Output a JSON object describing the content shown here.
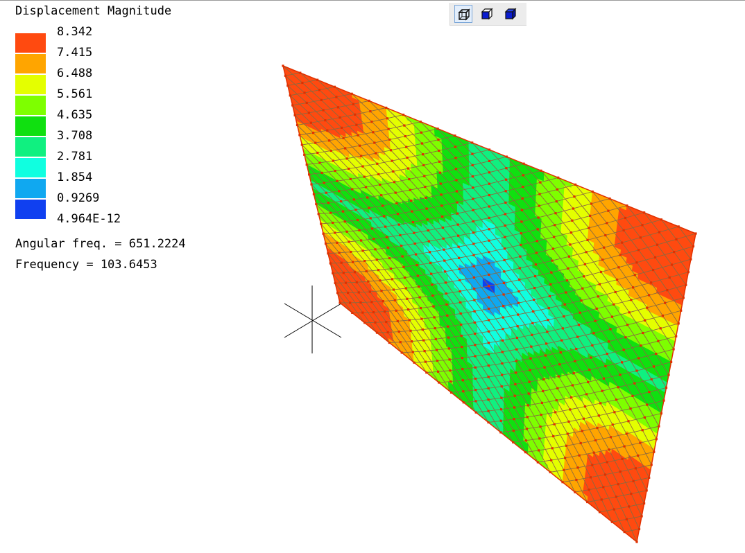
{
  "legend": {
    "title": "Displacement Magnitude",
    "entries": [
      {
        "label": "8.342",
        "color": "#ff4a10"
      },
      {
        "label": "7.415",
        "color": "#ffa500"
      },
      {
        "label": "6.488",
        "color": "#e4ff00"
      },
      {
        "label": "5.561",
        "color": "#7eff00"
      },
      {
        "label": "4.635",
        "color": "#10e010"
      },
      {
        "label": "3.708",
        "color": "#10f080"
      },
      {
        "label": "2.781",
        "color": "#10ffe0"
      },
      {
        "label": "1.854",
        "color": "#10a8f0"
      },
      {
        "label": "0.9269",
        "color": "#1040f0"
      },
      {
        "label": "4.964E-12",
        "color": ""
      }
    ]
  },
  "info": {
    "angular_freq": "Angular freq. = 651.2224",
    "frequency": "Frequency = 103.6453"
  },
  "toolbar": {
    "buttons": [
      {
        "icon": "wireframe-cube-icon",
        "active": true
      },
      {
        "icon": "hidden-line-cube-icon",
        "active": false
      },
      {
        "icon": "solid-cube-icon",
        "active": false
      }
    ]
  },
  "mesh": {
    "divisions": 24,
    "node_color": "#e03000",
    "grid_color": "#8a6a40"
  },
  "axes_icon": "coordinate-axes-icon"
}
